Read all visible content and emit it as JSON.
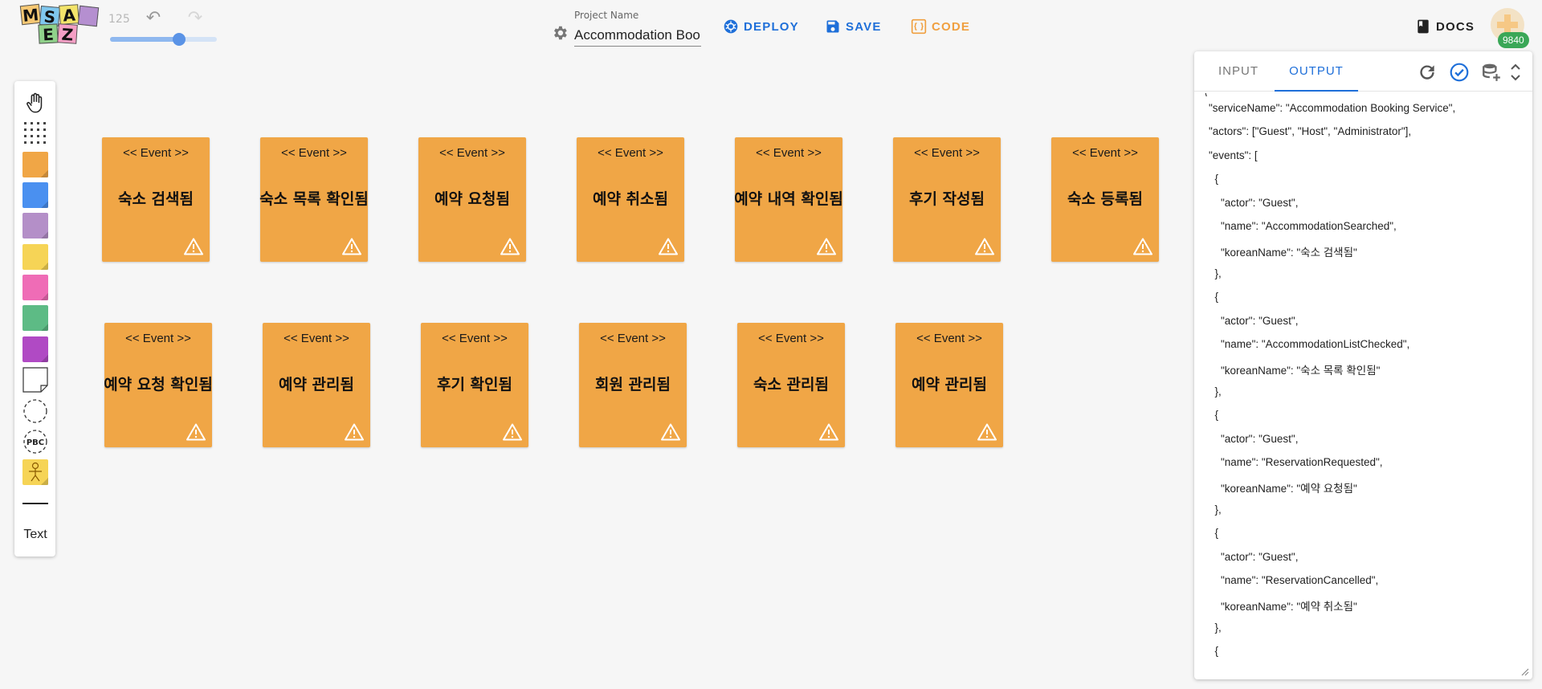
{
  "app": {
    "logo_letters": [
      "M",
      "S",
      "A",
      "E",
      "Z"
    ],
    "zoom": "125",
    "zoom_fraction": 0.65
  },
  "project": {
    "label": "Project Name",
    "value": "Accommodation Boo"
  },
  "toolbar": {
    "deploy": "DEPLOY",
    "save": "SAVE",
    "code": "CODE",
    "docs": "DOCS",
    "credits": "9840"
  },
  "palette": {
    "colors": [
      "#f0a646",
      "#4a90f0",
      "#b48fc8",
      "#f6d456",
      "#ef6cb6",
      "#5dbb85",
      "#b04ac4"
    ],
    "pbc": "PBC",
    "text": "Text"
  },
  "canvas": {
    "stereotype": "<< Event >>",
    "events": [
      "숙소 검색됨",
      "숙소 목록 확인됨",
      "예약 요청됨",
      "예약 취소됨",
      "예약 내역 확인됨",
      "후기 작성됨",
      "숙소 등록됨",
      "예약 요청 확인됨",
      "예약 관리됨",
      "후기 확인됨",
      "회원 관리됨",
      "숙소 관리됨",
      "예약 관리됨"
    ]
  },
  "panel": {
    "tab_input": "INPUT",
    "tab_output": "OUTPUT",
    "output_lines": [
      "\\",
      "\"serviceName\": \"Accommodation Booking Service\",",
      "\"actors\": [\"Guest\", \"Host\", \"Administrator\"],",
      "\"events\": [",
      "  {",
      "    \"actor\": \"Guest\",",
      "    \"name\": \"AccommodationSearched\",",
      "    \"koreanName\": \"숙소 검색됨\"",
      "  },",
      "  {",
      "    \"actor\": \"Guest\",",
      "    \"name\": \"AccommodationListChecked\",",
      "    \"koreanName\": \"숙소 목록 확인됨\"",
      "  },",
      "  {",
      "    \"actor\": \"Guest\",",
      "    \"name\": \"ReservationRequested\",",
      "    \"koreanName\": \"예약 요청됨\"",
      "  },",
      "  {",
      "    \"actor\": \"Guest\",",
      "    \"name\": \"ReservationCancelled\",",
      "    \"koreanName\": \"예약 취소됨\"",
      "  },",
      "  {"
    ]
  }
}
